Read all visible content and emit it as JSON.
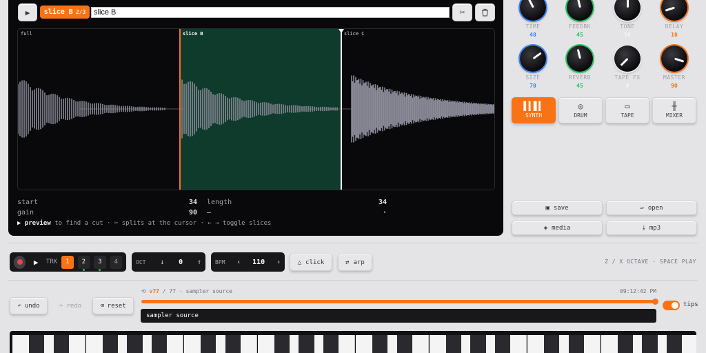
{
  "editor": {
    "active_slice": "slice B",
    "slice_count": "2/3",
    "slice_name_value": "slice B",
    "regions": [
      {
        "label": "full"
      },
      {
        "label": "slice B"
      },
      {
        "label": "slice C"
      }
    ],
    "info": {
      "start_label": "start",
      "start_value": "34",
      "length_label": "length",
      "length_value": "34",
      "gain_label": "gain",
      "gain_value": "90",
      "dash": "—",
      "dot": "·"
    },
    "hint_bold": "▶ preview",
    "hint_rest": " to find a cut · ✂ splits at the cursor · ← → toggle slices"
  },
  "knobs": [
    {
      "label": "TIME",
      "value": "40",
      "color": "#3b82f6"
    },
    {
      "label": "FEEDBK",
      "value": "45",
      "color": "#22c55e"
    },
    {
      "label": "TONE",
      "value": "50",
      "color": "#e5e5e5"
    },
    {
      "label": "DELAY",
      "value": "10",
      "color": "#f97316"
    },
    {
      "label": "SIZE",
      "value": "70",
      "color": "#3b82f6"
    },
    {
      "label": "REVERB",
      "value": "45",
      "color": "#22c55e"
    },
    {
      "label": "TAPE FX",
      "value": "0",
      "color": "#e5e5e5"
    },
    {
      "label": "MASTER",
      "value": "90",
      "color": "#f97316"
    }
  ],
  "modes": [
    {
      "label": "SYNTH",
      "icon": "waveform-icon"
    },
    {
      "label": "DRUM",
      "icon": "drum-icon"
    },
    {
      "label": "TAPE",
      "icon": "cassette-icon"
    },
    {
      "label": "MIXER",
      "icon": "sliders-icon"
    }
  ],
  "actions": {
    "save": "save",
    "open": "open",
    "media": "media",
    "mp3": "mp3"
  },
  "transport": {
    "trk_label": "TRK",
    "tracks": [
      "1",
      "2",
      "3",
      "4"
    ],
    "oct_label": "OCT",
    "oct_value": "0",
    "bpm_label": "BPM",
    "bpm_value": "110",
    "click": "click",
    "arp": "arp",
    "shortcut_hint": "Z / X OCTAVE · SPACE PLAY"
  },
  "history": {
    "undo": "undo",
    "redo": "redo",
    "reset": "reset",
    "version_current": "v77",
    "version_sep": " / 77 · sampler source",
    "time": "09:12:42 PM",
    "progress": 1.0,
    "source_label": "sampler source",
    "tips": "tips"
  },
  "colors": {
    "accent": "#f97316",
    "slice_fill": "#0f3b2c",
    "wave": "#8b8b99"
  }
}
